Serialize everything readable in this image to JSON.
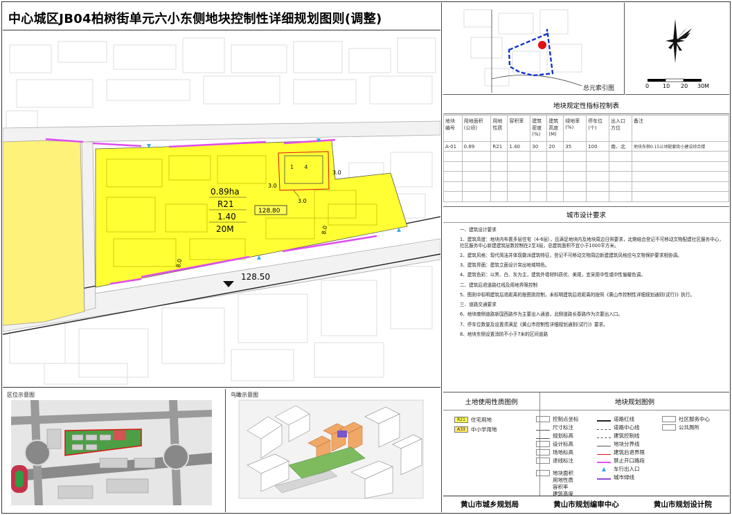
{
  "title": "中心城区JB04柏树街单元六小东侧地块控制性详细规划图则(调整)",
  "map": {
    "parcel": {
      "area": "0.89ha",
      "landuse": "R21",
      "far": "1.40",
      "height": "20M"
    },
    "elevation_box": "128.80",
    "elevation_road": "128.50",
    "setbacks": [
      "3.0",
      "3.0",
      "3.0"
    ],
    "road_widths": [
      "8.0",
      "8.0"
    ],
    "facility_mark": "1   4"
  },
  "index_map": {
    "caption": "总元索引图"
  },
  "compass": {
    "scale_labels": [
      "0",
      "10",
      "20",
      "30M"
    ]
  },
  "control_table": {
    "title": "地块规定性指标控制表",
    "headers": [
      "地块\n编号",
      "用地面积\n(公顷)",
      "用地\n性质",
      "容积率",
      "建筑\n密度\n(%)",
      "建筑\n高度\n(M)",
      "绿地率\n(%)",
      "停车位\n(个)",
      "出入口\n方位",
      "备注"
    ],
    "rows": [
      [
        "A-01",
        "0.89",
        "R21",
        "1.40",
        "30",
        "20",
        "35",
        "100",
        "南、北",
        "地块东侧0.15公顷配套街小建设综合楼"
      ]
    ]
  },
  "design": {
    "title": "城市设计要求",
    "lines": [
      "一、建筑设计要求",
      "1、建筑高度：地块内布置多层住宅（4-6层），且满足地块内及地块周边日照要求，北侧结合登记不可移动文物配建社区服务中心，社区服务中心新建建筑层数控制在2至3层，总建筑面积不宜小于1000平方米。",
      "2、建筑风格：现代简洁并体现徽派建筑特征，登记不可移动文物周边新建建筑风格应与文物保护要求相协调。",
      "3、建筑界面：建筑立面设计突出地域特色。",
      "4、建筑色彩：以黑、白、灰为主，建筑外墙材料质优、美观，宜采用中性或中性偏暖色调。",
      "二、建筑后退道路红线及用地界限控制",
      "5、图则中标明建筑后退距离的按图则控制，未标明建筑后退距离的按照《黄山市控制性详细规划通则(试行)》执行。",
      "三、道路交通要求",
      "6、地块南侧道路新国西路作为主要出入通道，北侧道路长春路作为次要出入口。",
      "7、停车位数量及设置须满足《黄山市控制性详细规划通则(试行)》要求。",
      "8、地块东侧设置消防不小于7米的区间道路"
    ]
  },
  "legend": {
    "land_title": "土地使用性质图例",
    "plan_title": "地块规划图例",
    "land_items": [
      {
        "code": "R21",
        "label": "住宅用地",
        "color": "#ffff55"
      },
      {
        "code": "A33",
        "label": "中小学用地",
        "color": "#ffe96a"
      }
    ],
    "plan_col1": [
      "控制点坐标",
      "尺寸标注",
      "规划标高",
      "设计标高",
      "场地标高",
      "退线标注",
      "",
      "地块面积",
      "用地性质",
      "容积率",
      "建筑高度"
    ],
    "plan_col2": [
      "道路红线",
      "道路中心线",
      "建筑控制线",
      "地块分界线",
      "建筑后退界限",
      "禁止开口路段",
      "车行出入口",
      "城市绿线"
    ],
    "plan_col3": [
      "社区服务中心",
      "公共厕所"
    ]
  },
  "insets": {
    "left_label": "区位示意图",
    "right_label": "鸟瞰示意图"
  },
  "footer": [
    "黄山市城乡规划局",
    "黄山市规划编审中心",
    "黄山市规划设计院"
  ]
}
